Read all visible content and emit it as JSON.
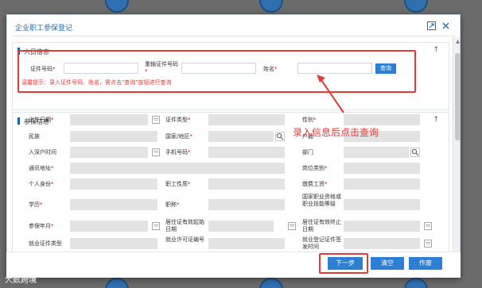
{
  "dialog": {
    "title": "企业职工参保登记"
  },
  "personal_section": {
    "title": "人员信息",
    "fields": {
      "id_number_label": "证件号码",
      "reenter_id_label": "重输证件号码",
      "name_label": "姓名",
      "required_mark": "*"
    },
    "query_button": "查询",
    "hint": "温馨提示：录入证件号码、姓名，需点击\"查询\"按钮进行查询"
  },
  "insurance_section": {
    "title": "参保信息",
    "labels": {
      "birth_date": "出生日期",
      "id_type": "证件类型",
      "gender": "性别",
      "ethnicity": "民族",
      "country_region": "国家/地区",
      "hukou": "户籍",
      "hukou_date": "入深户时间",
      "phone": "手机号码",
      "department": "部门",
      "address": "通讯地址",
      "post_category": "岗位类别",
      "personal_status": "个人身份",
      "employee_nature": "职工性质",
      "contribution_wage": "缴费工资",
      "education": "学历",
      "title": "职称",
      "skill_level": "国家职业资格或职业技能等级",
      "insured_month": "参保年月",
      "residence_start": "居住证有效起始日期",
      "residence_end": "居住证有效终止日期",
      "employment_cert_type": "就业证件类型",
      "work_permit_no": "就业许可证编号",
      "employment_reg_time": "就业登记证件签发时间"
    },
    "required_mark": "*"
  },
  "annotation": "录入信息后点击查询",
  "footer": {
    "next": "下一步",
    "clear": "清空",
    "cancel": "作废"
  },
  "watermark": "大数跨境",
  "colors": {
    "primary": "#2c7fd2",
    "title_blue": "#1f6fb7",
    "annotation_red": "#e53935"
  }
}
